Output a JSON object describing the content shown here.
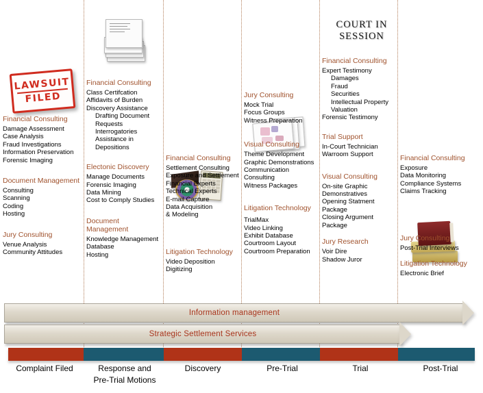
{
  "graphics": {
    "stamp": {
      "line1": "LAWSUIT",
      "line2": "FILED",
      "name": "lawsuit-filed-stamp"
    },
    "court_sign": {
      "line1": "COURT IN",
      "line2": "SESSION"
    }
  },
  "columns": [
    {
      "id": "complaint-filed",
      "groups": [
        {
          "title": "Financial Consulting",
          "items": "Damage Assessment\nCase Analysis\nFraud Investigations\nInformation Preservation\nForensic Imaging"
        },
        {
          "title": "Document Management",
          "items": "Consulting\nScanning\nCoding\nHosting"
        },
        {
          "title": "Jury Consulting",
          "items": "Venue Analysis\nCommunity Attitudes"
        }
      ]
    },
    {
      "id": "response-pretrial-motions",
      "groups": [
        {
          "title": "Financial Consulting",
          "items": "Class Certifcation\nAffidavits of Burden\nDiscovery Assistance",
          "subitems": "Drafting Document\n    Requests\nInterrogatories\nAssistance in\n    Depositions"
        },
        {
          "title": "Electonic Discovery",
          "items": "Manage Documents\nForensic Imaging\nData Mining\nCost to Comply Studies"
        },
        {
          "title": "Document\nManagement",
          "items": "Knowledge Management\nDatabase\nHosting"
        }
      ]
    },
    {
      "id": "discovery",
      "groups": [
        {
          "title": "Financial Consulting",
          "items": "Settlement Consulting\nExposure and Settlement\nFinancial Experts\nTechnical Experts\nE-mail Capture\nData Acquisition\n& Modeling"
        },
        {
          "title": "Litigation Technology",
          "items": "Video Deposition\nDigitizing"
        }
      ]
    },
    {
      "id": "pre-trial",
      "groups": [
        {
          "title": "Jury Consulting",
          "items": "Mock Trial\nFocus Groups\nWitness Preparation"
        },
        {
          "title": "Visual Consulting",
          "items": "Theme Development\nGraphic Demonstrations\nCommunication\nConsulting\nWitness Packages"
        },
        {
          "title": "Litigation Technology",
          "items": "TrialMax\nVideo Linking\nExhibit Database\nCourtroom Layout\nCourtroom Preparation"
        }
      ]
    },
    {
      "id": "trial",
      "groups": [
        {
          "title": "Financial Consulting",
          "items": "Expert Testimony",
          "subitems": "Damages\nFraud\nSecurities\nIntellectual Property\nValuation",
          "items_after": "Forensic Testimony"
        },
        {
          "title": "Trial Support",
          "items": "In-Court Technician\nWarroom Support"
        },
        {
          "title": "Visual Consulting",
          "items": "On-site Graphic\nDemonstratives\nOpening Statment\nPackage\nClosing Argument\nPackage"
        },
        {
          "title": "Jury Research",
          "items": "Voir Dire\nShadow Juror"
        }
      ]
    },
    {
      "id": "post-trial",
      "groups": [
        {
          "title": "Financial Consulting",
          "items": "Exposure\nData Monitoring\nCompliance Systems\nClaims Tracking"
        },
        {
          "title": "Jury Consulting",
          "items": "Post-Trial Interviews"
        },
        {
          "title": "Litigation Technology",
          "items": "Electronic Brief"
        }
      ]
    }
  ],
  "banners": [
    {
      "label": "Information management"
    },
    {
      "label": "Strategic Settlement Services"
    }
  ],
  "timeline": {
    "segments": [
      {
        "label": "Complaint Filed",
        "color": "#b03318"
      },
      {
        "label": "Response and\nPre-Trial Motions",
        "color": "#1c5a70"
      },
      {
        "label": "Discovery",
        "color": "#b03318"
      },
      {
        "label": "Pre-Trial",
        "color": "#1c5a70"
      },
      {
        "label": "Trial",
        "color": "#b03318"
      },
      {
        "label": "Post-Trial",
        "color": "#1c5a70"
      }
    ]
  },
  "colors": {
    "heading": "#a0522d",
    "banner_text": "#a8341c",
    "phase_red": "#b03318",
    "phase_teal": "#1c5a70",
    "separator": "#b07a55"
  }
}
